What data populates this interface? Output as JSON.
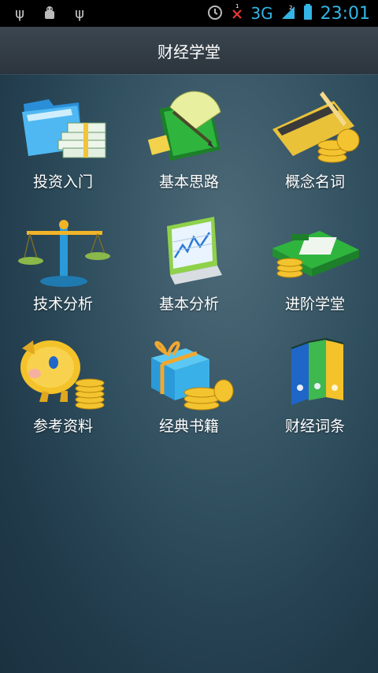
{
  "status_bar": {
    "icons_left": [
      "usb-icon",
      "android-debug-icon",
      "usb-icon"
    ],
    "icons_right": [
      "alarm-icon",
      "no-signal-icon",
      "3g-icon",
      "signal-icon",
      "battery-icon"
    ],
    "network": "3G",
    "time": "23:01",
    "accent_color": "#33b5e5"
  },
  "header": {
    "title": "财经学堂"
  },
  "menu": {
    "items": [
      {
        "label": "投资入门",
        "icon": "folder-money-icon"
      },
      {
        "label": "基本思路",
        "icon": "book-protractor-icon"
      },
      {
        "label": "概念名词",
        "icon": "card-coins-icon"
      },
      {
        "label": "技术分析",
        "icon": "scale-icon"
      },
      {
        "label": "基本分析",
        "icon": "monitor-chart-icon"
      },
      {
        "label": "进阶学堂",
        "icon": "calculator-coins-icon"
      },
      {
        "label": "参考资料",
        "icon": "piggy-bank-icon"
      },
      {
        "label": "经典书籍",
        "icon": "gift-coins-icon"
      },
      {
        "label": "财经词条",
        "icon": "binders-icon"
      }
    ]
  }
}
